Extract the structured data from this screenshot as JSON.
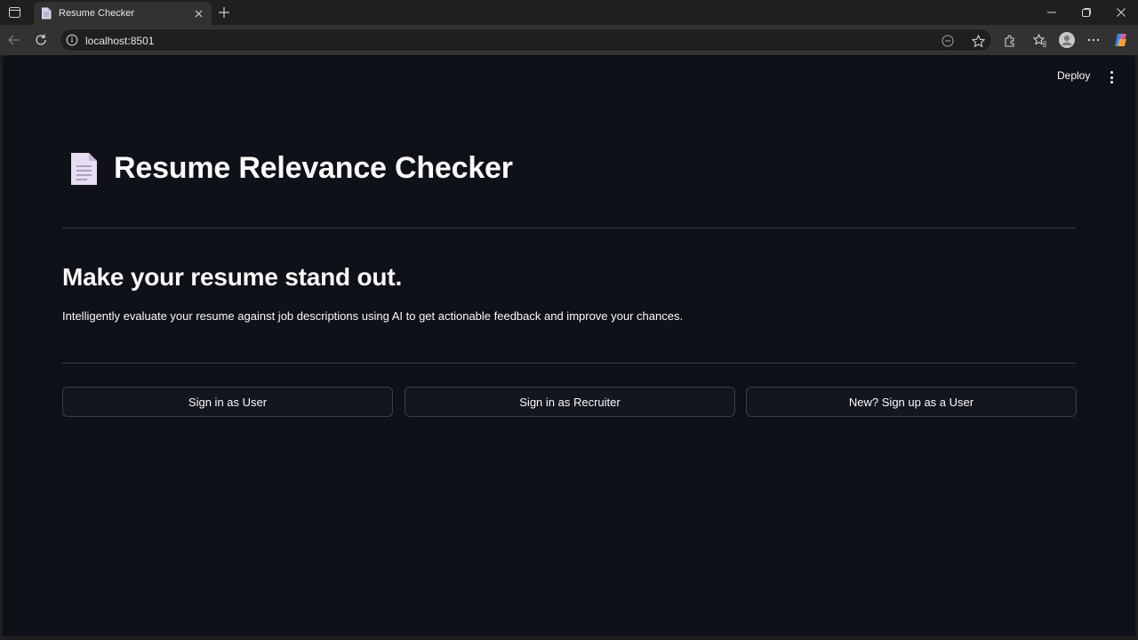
{
  "browser": {
    "tab_title": "Resume Checker",
    "url": "localhost:8501"
  },
  "icons": {
    "tab_actions": "tab-actions-icon",
    "favicon": "document-icon",
    "tab_close": "close-icon",
    "new_tab": "plus-icon",
    "minimize": "minimize-icon",
    "restore": "restore-icon",
    "window_close": "close-icon",
    "back": "back-arrow-icon",
    "refresh": "refresh-icon",
    "site_info": "info-icon",
    "reader": "reader-mode-icon",
    "favorite": "star-icon",
    "extensions": "puzzle-icon",
    "favorites_bar": "favorites-icon",
    "profile": "avatar-icon",
    "more": "ellipsis-icon",
    "copilot": "copilot-icon"
  },
  "app": {
    "deploy_label": "Deploy",
    "title": "Resume Relevance Checker",
    "headline": "Make your resume stand out.",
    "subtitle": "Intelligently evaluate your resume against job descriptions using AI to get actionable feedback and improve your chances.",
    "buttons": {
      "user_signin": "Sign in as User",
      "recruiter_signin": "Sign in as Recruiter",
      "user_signup": "New? Sign up as a User"
    }
  },
  "colors": {
    "page_bg": "#0e1117",
    "text": "#fafafa",
    "button_bg": "#13161e",
    "border": "#3b3d45"
  }
}
